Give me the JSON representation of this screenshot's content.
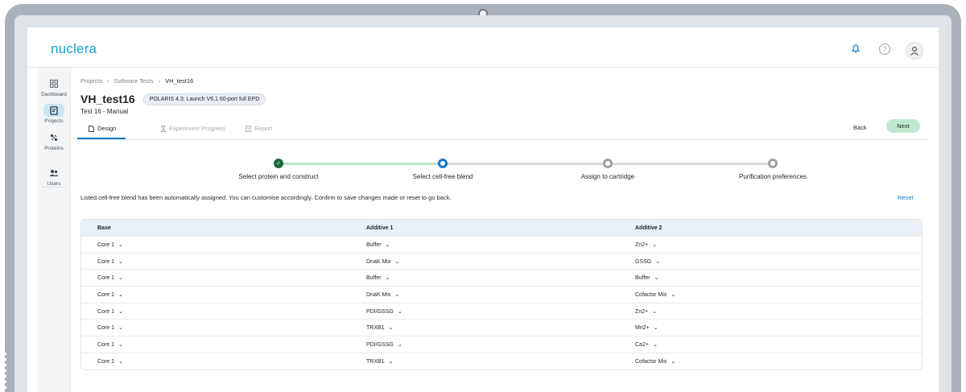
{
  "app": {
    "logo": "nuclera"
  },
  "topbar": {
    "bell_icon": "bell-icon",
    "help_icon": "help-icon",
    "avatar_icon": "user-icon"
  },
  "sidebar": {
    "items": [
      {
        "label": "Dashboard",
        "icon": "grid-icon",
        "active": false
      },
      {
        "label": "Projects",
        "icon": "document-icon",
        "active": true
      },
      {
        "label": "Proteins",
        "icon": "protein-icon",
        "active": false
      },
      {
        "label": "Users",
        "icon": "users-icon",
        "active": false
      }
    ]
  },
  "breadcrumb": {
    "items": [
      "Projects",
      "Software Tests",
      "VH_test16"
    ]
  },
  "page": {
    "title": "VH_test16",
    "chip": "POLARIS 4.3: Launch V6.1 60-port full EPD",
    "subtitle": "Test 16 - Manual"
  },
  "tabs": [
    {
      "label": "Design",
      "icon": "file-icon",
      "active": true
    },
    {
      "label": "Experiment Progress",
      "icon": "hourglass-icon",
      "active": false
    },
    {
      "label": "Report",
      "icon": "report-icon",
      "active": false
    }
  ],
  "actions": {
    "back": "Back",
    "next": "Next"
  },
  "stepper": {
    "steps": [
      {
        "label": "Select protein and construct",
        "state": "done"
      },
      {
        "label": "Select cell-free blend",
        "state": "current"
      },
      {
        "label": "Assign to cartridge",
        "state": "todo"
      },
      {
        "label": "Purification preferences",
        "state": "todo"
      }
    ]
  },
  "info_text": "Listed cell-free blend has been automatically assigned. You can customise accordingly. Confirm to save changes made or reset to go back.",
  "reset_label": "Reset",
  "table": {
    "headers": [
      "Base",
      "Additive 1",
      "Additive 2"
    ],
    "rows": [
      [
        "Core 1",
        "Buffer",
        "Zn2+"
      ],
      [
        "Core 1",
        "DnaK Mix",
        "GSSG"
      ],
      [
        "Core 1",
        "Buffer",
        "Buffer"
      ],
      [
        "Core 1",
        "DnaK Mix",
        "Cofactor Mix"
      ],
      [
        "Core 1",
        "PDI/GSSG",
        "Zn2+"
      ],
      [
        "Core 1",
        "TRXB1",
        "Mn2+"
      ],
      [
        "Core 1",
        "PDI/GSSG",
        "Ca2+"
      ],
      [
        "Core 1",
        "TRXB1",
        "Cofactor Mix"
      ]
    ]
  },
  "colors": {
    "accent": "#1676c7",
    "logo": "#1aa0d8",
    "next_button": "#bfe9cf",
    "step_done": "#1e6b3a",
    "annotation_arrow": "#5a1836"
  }
}
